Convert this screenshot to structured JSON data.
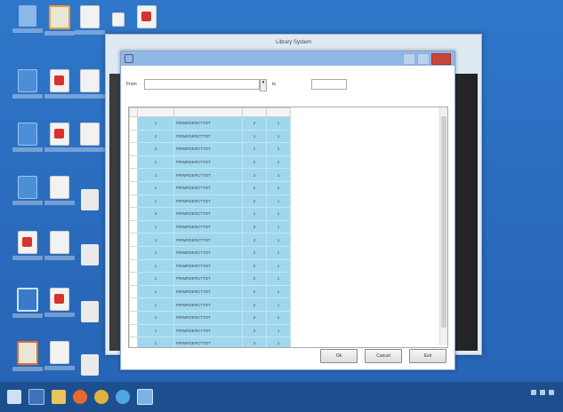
{
  "outer_window": {
    "title": "Library System"
  },
  "dialog": {
    "title": ""
  },
  "filter": {
    "from_label": "From",
    "from_value": "",
    "to_label": "to",
    "to_value": ""
  },
  "grid": {
    "columns": [
      "",
      "",
      "",
      "",
      ""
    ],
    "rows": [
      {
        "c1": "",
        "c2": "1",
        "c3": "PRIMRDERCTTDT",
        "c4": "2",
        "c5": "1"
      },
      {
        "c1": "",
        "c2": "2",
        "c3": "PRIMRDERCTTDT",
        "c4": "1",
        "c5": "1"
      },
      {
        "c1": "",
        "c2": "3",
        "c3": "PRIMRDERCTTDT",
        "c4": "1",
        "c5": "1"
      },
      {
        "c1": "",
        "c2": "1",
        "c3": "PRIMRDERCTTDT",
        "c4": "2",
        "c5": "1"
      },
      {
        "c1": "",
        "c2": "1",
        "c3": "PRIMRDERCTTDT",
        "c4": "2",
        "c5": "1"
      },
      {
        "c1": "",
        "c2": "1",
        "c3": "PRIMRDERCTTDT",
        "c4": "2",
        "c5": "1"
      },
      {
        "c1": "",
        "c2": "1",
        "c3": "PRIMRDERCTTDT",
        "c4": "2",
        "c5": "1"
      },
      {
        "c1": "",
        "c2": "3",
        "c3": "PRIMRDERCTTDT",
        "c4": "1",
        "c5": "1"
      },
      {
        "c1": "",
        "c2": "1",
        "c3": "PRIMRDERCTTDT",
        "c4": "2",
        "c5": "1"
      },
      {
        "c1": "",
        "c2": "1",
        "c3": "PRIMRDERCTTDT",
        "c4": "2",
        "c5": "1"
      },
      {
        "c1": "",
        "c2": "1",
        "c3": "PRIMRDERCTTDT",
        "c4": "2",
        "c5": "1"
      },
      {
        "c1": "",
        "c2": "1",
        "c3": "PRIMRDERCTTDT",
        "c4": "2",
        "c5": "1"
      },
      {
        "c1": "",
        "c2": "1",
        "c3": "PRIMRDERCTTDT",
        "c4": "2",
        "c5": "1"
      },
      {
        "c1": "",
        "c2": "1",
        "c3": "PRIMRDERCTTDT",
        "c4": "2",
        "c5": "1"
      },
      {
        "c1": "",
        "c2": "1",
        "c3": "PRIMRDERCTTDT",
        "c4": "2",
        "c5": "1"
      },
      {
        "c1": "",
        "c2": "1",
        "c3": "PRIMRDERCTTDT",
        "c4": "2",
        "c5": "1"
      },
      {
        "c1": "",
        "c2": "1",
        "c3": "PRIMRDERCTTDT",
        "c4": "2",
        "c5": "1"
      },
      {
        "c1": "",
        "c2": "1",
        "c3": "PRIMRDERCTTDT",
        "c4": "2",
        "c5": "1"
      }
    ]
  },
  "buttons": {
    "ok": "Ok",
    "cancel": "Cancel",
    "exit": "Exit"
  },
  "icons": {
    "desktop": [
      "recycle-bin-icon",
      "browser-icon",
      "document-icon",
      "pdf-icon"
    ],
    "taskbar": [
      "windows-start-icon",
      "store-icon",
      "file-explorer-icon",
      "firefox-icon",
      "chrome-icon",
      "internet-explorer-icon",
      "app-icon"
    ]
  },
  "colors": {
    "desktop_bg": "#2f77c9",
    "grid_row_bg": "#9fd7ee",
    "taskbar_bg": "#1d4f8f",
    "close_button": "#c9463d"
  }
}
